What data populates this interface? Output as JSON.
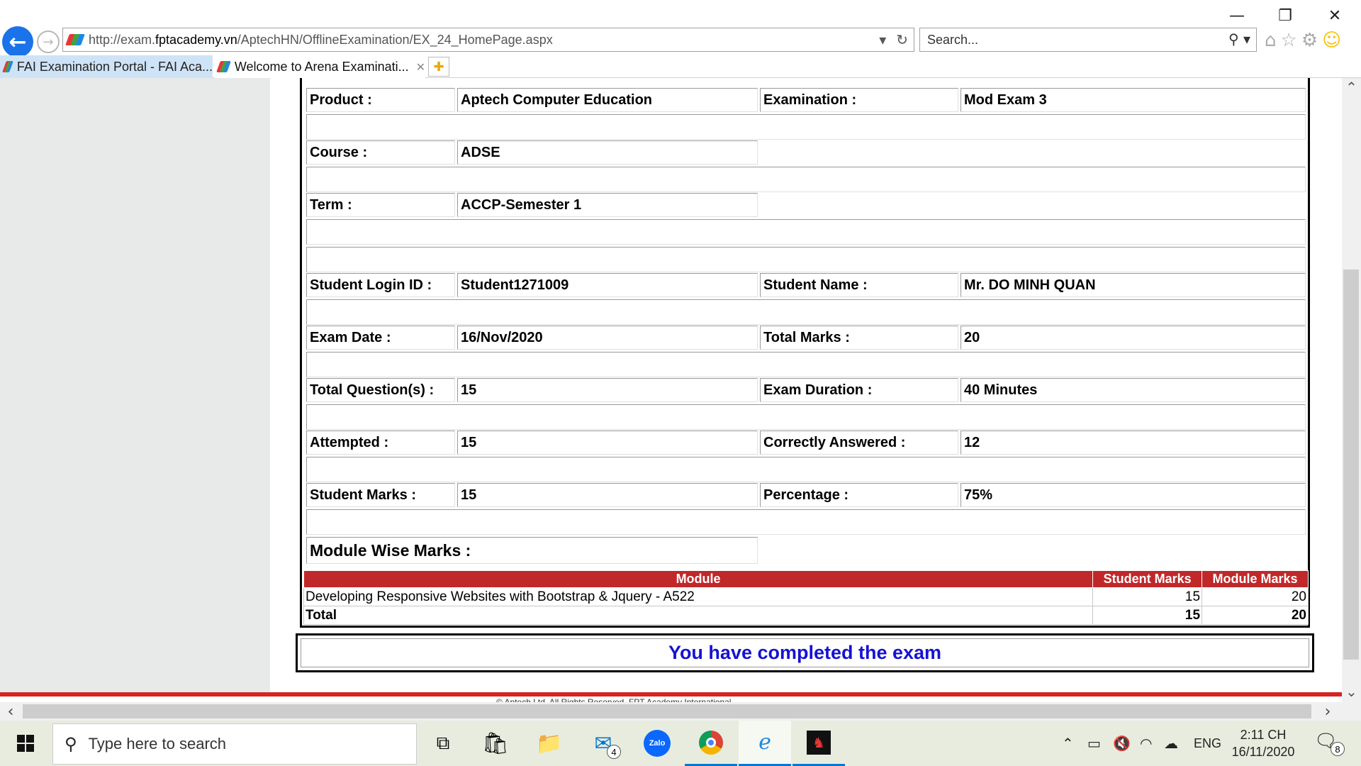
{
  "browser": {
    "url_prefix": "http://exam.",
    "url_domain": "fptacademy.vn",
    "url_path": "/AptechHN/OfflineExamination/EX_24_HomePage.aspx",
    "search_placeholder": "Search...",
    "tabs": [
      {
        "label": "FAI Examination Portal - FAI Aca..."
      },
      {
        "label": "Welcome to Arena Examinati..."
      }
    ],
    "tab_close": "✕"
  },
  "exam": {
    "product_label": "Product :",
    "product_value": "Aptech Computer Education",
    "examination_label": "Examination :",
    "examination_value": "Mod Exam 3",
    "course_label": "Course :",
    "course_value": "ADSE",
    "term_label": "Term :",
    "term_value": "ACCP-Semester 1",
    "login_label": "Student Login ID :",
    "login_value": "Student1271009",
    "name_label": "Student Name :",
    "name_value": "Mr. DO MINH QUAN",
    "date_label": "Exam Date :",
    "date_value": "16/Nov/2020",
    "total_marks_label": "Total Marks :",
    "total_marks_value": "20",
    "questions_label": "Total Question(s) :",
    "questions_value": "15",
    "duration_label": "Exam Duration :",
    "duration_value": "40 Minutes",
    "attempted_label": "Attempted :",
    "attempted_value": "15",
    "correct_label": "Correctly Answered :",
    "correct_value": "12",
    "student_marks_label": "Student Marks :",
    "student_marks_value": "15",
    "percentage_label": "Percentage :",
    "percentage_value": "75%",
    "module_heading": "Module Wise Marks :"
  },
  "module_table": {
    "headers": [
      "Module",
      "Student Marks",
      "Module Marks"
    ],
    "rows": [
      {
        "module": "Developing Responsive Websites with Bootstrap & Jquery - A522",
        "student_marks": "15",
        "module_marks": "20"
      }
    ],
    "total": {
      "label": "Total",
      "student_marks": "15",
      "module_marks": "20"
    }
  },
  "completed_message": "You have completed the exam",
  "footer_text": "© Aptech Ltd. All Rights Reserved. FPT Academy International",
  "taskbar": {
    "search_placeholder": "Type here to search",
    "mail_badge": "4",
    "zalo_label": "Zalo",
    "language": "ENG",
    "time": "2:11 CH",
    "date": "16/11/2020",
    "notification_count": "8"
  },
  "colors": {
    "table_header_bg": "#c0282a",
    "completed_text": "#1512d4",
    "footer_line": "#d42424",
    "accent": "#0078d7"
  }
}
